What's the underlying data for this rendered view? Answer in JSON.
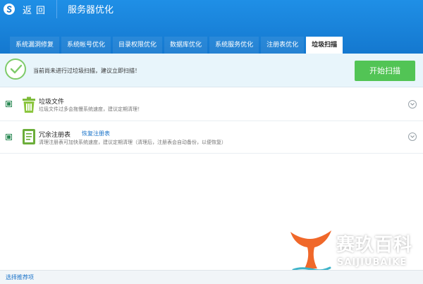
{
  "header": {
    "back_label": "返回",
    "title": "服务器优化"
  },
  "tabs": [
    {
      "label": "系统漏洞修复"
    },
    {
      "label": "系统帐号优化"
    },
    {
      "label": "目录权限优化"
    },
    {
      "label": "数据库优化"
    },
    {
      "label": "系统服务优化"
    },
    {
      "label": "注册表优化"
    },
    {
      "label": "垃圾扫描",
      "active": true
    }
  ],
  "status": {
    "message": "当前尚未进行过垃圾扫描，建议立即扫描！",
    "scan_button": "开始扫描"
  },
  "items": [
    {
      "title": "垃圾文件",
      "description": "垃圾文件过多会拖慢系统速度，建议定期清理！",
      "icon": "trash-icon"
    },
    {
      "title": "冗余注册表",
      "link": "恢复注册表",
      "description": "清理注册表可加快系统速度，建议定期清理（清理后，注册表会自动备份，以便恢复）",
      "icon": "registry-icon"
    }
  ],
  "footer": {
    "select_recommended": "选择推荐项"
  },
  "watermark": {
    "cn": "赛玖百科",
    "en": "SAIJIUBAIKE"
  },
  "colors": {
    "header": "#1478cf",
    "scan_button": "#52c455",
    "status_bg": "#e8f5fb",
    "link": "#1a73c9"
  }
}
